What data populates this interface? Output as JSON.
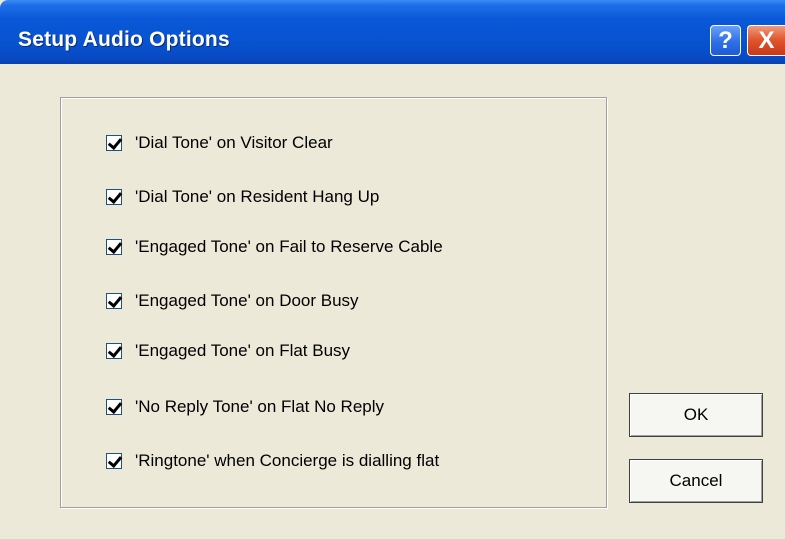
{
  "window": {
    "title": "Setup Audio Options",
    "help_button": "?",
    "close_button": "X"
  },
  "options": [
    {
      "label": "'Dial Tone' on Visitor Clear",
      "checked": true
    },
    {
      "label": "'Dial Tone' on Resident Hang Up",
      "checked": true
    },
    {
      "label": "'Engaged Tone' on Fail to Reserve Cable",
      "checked": true
    },
    {
      "label": "'Engaged Tone' on Door Busy",
      "checked": true
    },
    {
      "label": "'Engaged Tone' on Flat Busy",
      "checked": true
    },
    {
      "label": "'No Reply Tone' on Flat No Reply",
      "checked": true
    },
    {
      "label": "'Ringtone' when Concierge is dialling flat",
      "checked": true
    }
  ],
  "buttons": {
    "ok": "OK",
    "cancel": "Cancel"
  }
}
